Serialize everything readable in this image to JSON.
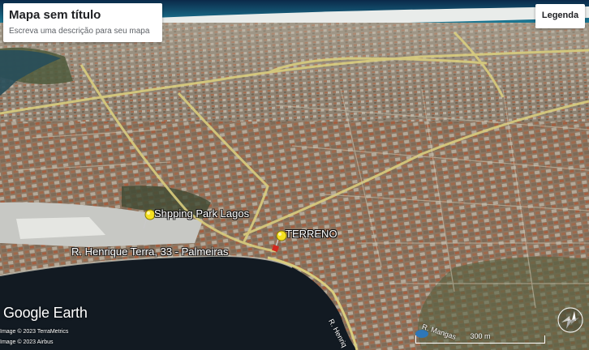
{
  "map": {
    "title": "Mapa sem título",
    "description": "Escreva uma descrição para seu mapa",
    "legend_label": "Legenda"
  },
  "placemarks": [
    {
      "label": "Shpping Park Lagos",
      "pin_color": "#f5e021"
    },
    {
      "label": "TERRENO",
      "pin_color": "#f5e021"
    }
  ],
  "road_labels": {
    "main": "R. Henrique Terra, 33 - Palmeiras",
    "side_1": "R. Henriq",
    "side_2": "R. Mangas"
  },
  "branding": {
    "logo": "Google Earth",
    "credit_1": "Image © 2023 TerraMetrics",
    "credit_2": "Image © 2023 Airbus"
  },
  "scale_bar": {
    "label": "300 m"
  },
  "colors": {
    "sea": "#0a3b5a",
    "lagoon": "#121a22",
    "urban": "#8a7560",
    "road": "#d8cc7a",
    "marker": "#f5e021"
  }
}
